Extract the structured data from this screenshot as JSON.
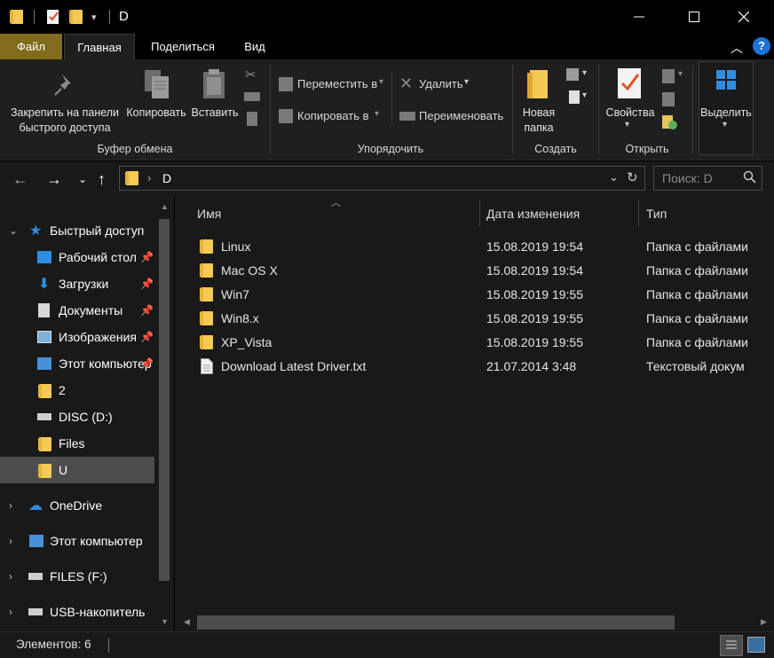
{
  "window": {
    "title": "D",
    "controls": [
      "minimize-icon",
      "maximize-icon",
      "close-icon"
    ]
  },
  "ribbon": {
    "tabs": [
      {
        "label": "Файл"
      },
      {
        "label": "Главная",
        "active": true
      },
      {
        "label": "Поделиться"
      },
      {
        "label": "Вид"
      }
    ],
    "clipboard": {
      "pin_label_1": "Закрепить на панели",
      "pin_label_2": "быстрого доступа",
      "copy_label": "Копировать",
      "paste_label": "Вставить",
      "group_label": "Буфер обмена"
    },
    "organize": {
      "move_label": "Переместить в",
      "copy_to_label": "Копировать в",
      "delete_label": "Удалить",
      "rename_label": "Переименовать",
      "group_label": "Упорядочить"
    },
    "create": {
      "new_folder_1": "Новая",
      "new_folder_2": "папка",
      "group_label": "Создать"
    },
    "open": {
      "properties_label": "Свойства",
      "group_label": "Открыть"
    },
    "select": {
      "select_label": "Выделить"
    }
  },
  "address": {
    "path": "D",
    "search_placeholder": "Поиск: D"
  },
  "nav": {
    "items": [
      {
        "label": "Быстрый доступ",
        "icon": "star-icon"
      },
      {
        "label": "Рабочий стол",
        "icon": "desktop-icon"
      },
      {
        "label": "Загрузки",
        "icon": "download-icon"
      },
      {
        "label": "Документы",
        "icon": "documents-icon"
      },
      {
        "label": "Изображения",
        "icon": "pictures-icon"
      },
      {
        "label": "Этот компьютер",
        "icon": "computer-icon"
      },
      {
        "label": "2",
        "icon": "folder-icon"
      },
      {
        "label": "DISC (D:)",
        "icon": "drive-icon"
      },
      {
        "label": "Files",
        "icon": "folder-icon"
      },
      {
        "label": "U",
        "icon": "folder-icon"
      },
      {
        "label": "OneDrive",
        "icon": "cloud-icon"
      },
      {
        "label": "Этот компьютер",
        "icon": "computer-icon"
      },
      {
        "label": "FILES (F:)",
        "icon": "drive-icon"
      },
      {
        "label": "USB-накопитель",
        "icon": "usb-drive-icon"
      }
    ]
  },
  "files": {
    "columns": {
      "name": "Имя",
      "date": "Дата изменения",
      "type": "Тип"
    },
    "rows": [
      {
        "name": "Linux",
        "date": "15.08.2019 19:54",
        "type": "Папка с файлами",
        "icon": "folder-icon"
      },
      {
        "name": "Mac OS X",
        "date": "15.08.2019 19:54",
        "type": "Папка с файлами",
        "icon": "folder-icon"
      },
      {
        "name": "Win7",
        "date": "15.08.2019 19:55",
        "type": "Папка с файлами",
        "icon": "folder-icon"
      },
      {
        "name": "Win8.x",
        "date": "15.08.2019 19:55",
        "type": "Папка с файлами",
        "icon": "folder-icon"
      },
      {
        "name": "XP_Vista",
        "date": "15.08.2019 19:55",
        "type": "Папка с файлами",
        "icon": "folder-icon"
      },
      {
        "name": "Download Latest Driver.txt",
        "date": "21.07.2014 3:48",
        "type": "Текстовый докум",
        "icon": "text-file-icon"
      }
    ]
  },
  "status": {
    "items_count": "Элементов: 6"
  }
}
